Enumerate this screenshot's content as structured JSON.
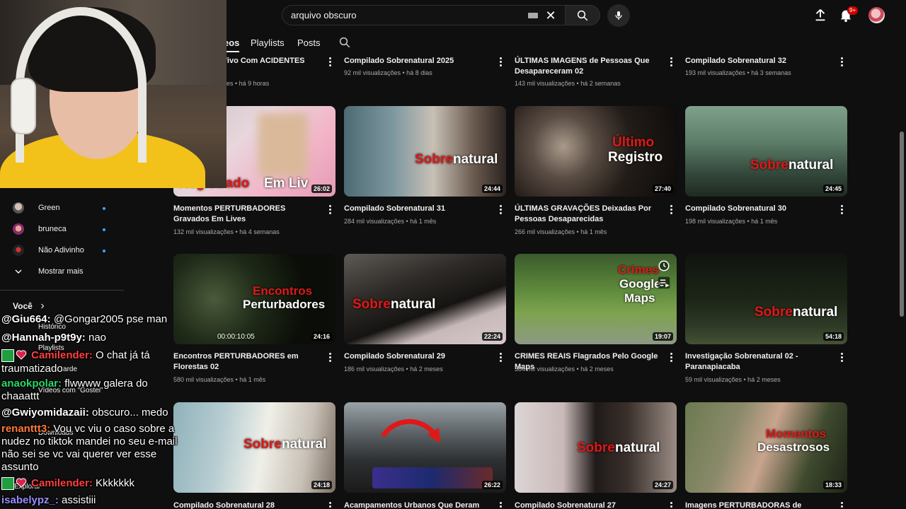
{
  "search": {
    "value": "arquivo obscuro"
  },
  "notifications_badge": "9+",
  "tabs": [
    "eos",
    "Playlists",
    "Posts"
  ],
  "sidebar": {
    "subscriptions": [
      {
        "name": "Green"
      },
      {
        "name": "bruneca"
      },
      {
        "name": "Não Adivinho"
      }
    ],
    "show_more": "Mostrar mais",
    "you_header": "Você",
    "you_items": [
      "Histórico",
      "Playlists",
      "...mais tarde",
      "Vídeos com \"Gostei\"",
      "Downloads",
      "Explorar"
    ]
  },
  "chat": [
    {
      "user": "@Giu664:",
      "msg": "@Gongar2005 pse man",
      "color": "#ffffff"
    },
    {
      "user": "@Hannah-p9t9y:",
      "msg": "nao",
      "color": "#ffffff"
    },
    {
      "user": "Camilender:",
      "msg": "O chat já tá",
      "color": "#ff4040",
      "badges": true
    },
    {
      "user": "",
      "msg": "traumatizado",
      "color": "#ffffff"
    },
    {
      "user": "anaokpolar:",
      "msg": "flwwww galera do",
      "color": "#2bd96b"
    },
    {
      "user": "",
      "msg": "chaaattt",
      "color": "#ffffff"
    },
    {
      "user": "@Gwiyomidazaii:",
      "msg": "obscuro... medo",
      "color": "#ffffff"
    },
    {
      "user": "renanttt3:",
      "msg": "Vou vc viu o caso sobre a",
      "color": "#ff7a3c"
    },
    {
      "user": "",
      "msg": "nudez no tiktok mandei no seu e-mail",
      "color": "#ffffff"
    },
    {
      "user": "",
      "msg": "não sei se vc vai querer ver esse",
      "color": "#ffffff"
    },
    {
      "user": "",
      "msg": "assunto",
      "color": "#ffffff"
    },
    {
      "user": "Camilender:",
      "msg": "Kkkkkkk",
      "color": "#ff4040",
      "badges": true
    },
    {
      "user": "isabelypz_:",
      "msg": "assistiii",
      "color": "#9a8cff"
    }
  ],
  "videos": [
    {
      "title": "o Vivo Com ACIDENTES",
      "meta": "es • há 9 horas"
    },
    {
      "title": "Compilado Sobrenatural 2025",
      "meta": "92 mil visualizações • há 8 dias"
    },
    {
      "title": "ÚLTIMAS IMAGENS de Pessoas Que Desapareceram 02",
      "meta": "143 mil visualizações • há 2 semanas"
    },
    {
      "title": "Compilado Sobrenatural 32",
      "meta": "193 mil visualizações • há 3 semanas"
    },
    {
      "title": "Momentos PERTURBADORES Gravados Em Lives",
      "meta": "132 mil visualizações • há 4 semanas",
      "duration": "26:02",
      "overlay": [
        "Registrado",
        "Em Liv"
      ]
    },
    {
      "title": "Compilado Sobrenatural 31",
      "meta": "284 mil visualizações • há 1 mês",
      "duration": "24:44",
      "overlay": [
        "Sobre",
        "natural"
      ]
    },
    {
      "title": "ÚLTIMAS GRAVAÇÕES Deixadas Por Pessoas Desaparecidas",
      "meta": "266 mil visualizações • há 1 mês",
      "duration": "27:40",
      "overlay": [
        "Último",
        "Registro"
      ]
    },
    {
      "title": "Compilado Sobrenatural 30",
      "meta": "198 mil visualizações • há 1 mês",
      "duration": "24:45",
      "overlay": [
        "Sobre",
        "natural"
      ]
    },
    {
      "title": "Encontros PERTURBADORES em Florestas 02",
      "meta": "580 mil visualizações • há 1 mês",
      "duration": "24:16",
      "overlay": [
        "Encontros",
        "Perturbadores"
      ],
      "timestamp": "00:00:10:05"
    },
    {
      "title": "Compilado Sobrenatural 29",
      "meta": "186 mil visualizações • há 2 meses",
      "duration": "22:24",
      "overlay": [
        "Sobre",
        "natural"
      ]
    },
    {
      "title": "CRIMES REAIS Flagrados Pelo Google Maps",
      "meta": "384 mil visualizações • há 2 meses",
      "duration": "19:07",
      "overlay": [
        "Crimes",
        "Google",
        "Maps"
      ]
    },
    {
      "title": "Investigação Sobrenatural 02 - Paranapiacaba",
      "meta": "59 mil visualizações • há 2 meses",
      "duration": "54:18",
      "overlay": [
        "Sobre",
        "natural"
      ]
    },
    {
      "title": "Compilado Sobrenatural 28",
      "meta": "",
      "duration": "24:18",
      "overlay": [
        "Sobre",
        "natural"
      ]
    },
    {
      "title": "Acampamentos Urbanos Que Deram",
      "meta": "",
      "duration": "26:22"
    },
    {
      "title": "Compilado Sobrenatural 27",
      "meta": "",
      "duration": "24:27",
      "overlay": [
        "Sobre",
        "natural"
      ]
    },
    {
      "title": "Imagens PERTURBADORAS de Momentos",
      "meta": "",
      "duration": "18:33",
      "overlay": [
        "Momentos",
        "Desastrosos"
      ]
    }
  ],
  "colors": {
    "background": "#0f0f0f",
    "accent_red": "#e01818",
    "live_dot": "#3ea6ff"
  }
}
